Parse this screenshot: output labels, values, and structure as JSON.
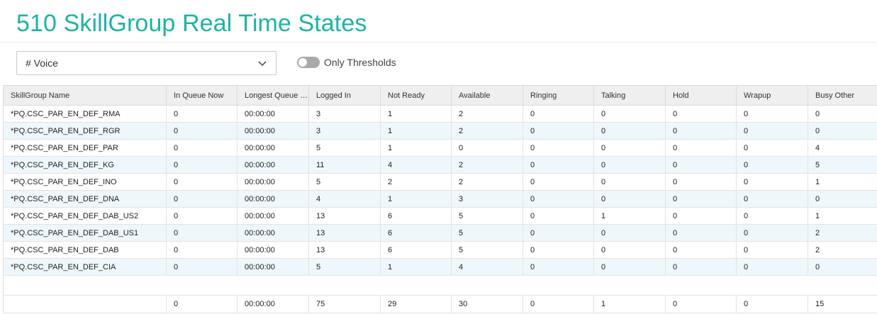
{
  "page": {
    "title": "510 SkillGroup Real Time States"
  },
  "filter": {
    "selected": "# Voice"
  },
  "toggle": {
    "label": "Only Thresholds",
    "on": false
  },
  "table": {
    "columns": [
      "SkillGroup Name",
      "In Queue Now",
      "Longest Queue T...",
      "Logged In",
      "Not Ready",
      "Available",
      "Ringing",
      "Talking",
      "Hold",
      "Wrapup",
      "Busy Other"
    ],
    "rows": [
      [
        "*PQ.CSC_PAR_EN_DEF_RMA",
        "0",
        "00:00:00",
        "3",
        "1",
        "2",
        "0",
        "0",
        "0",
        "0",
        "0"
      ],
      [
        "*PQ.CSC_PAR_EN_DEF_RGR",
        "0",
        "00:00:00",
        "3",
        "1",
        "2",
        "0",
        "0",
        "0",
        "0",
        "0"
      ],
      [
        "*PQ.CSC_PAR_EN_DEF_PAR",
        "0",
        "00:00:00",
        "5",
        "1",
        "0",
        "0",
        "0",
        "0",
        "0",
        "4"
      ],
      [
        "*PQ.CSC_PAR_EN_DEF_KG",
        "0",
        "00:00:00",
        "11",
        "4",
        "2",
        "0",
        "0",
        "0",
        "0",
        "5"
      ],
      [
        "*PQ.CSC_PAR_EN_DEF_INO",
        "0",
        "00:00:00",
        "5",
        "2",
        "2",
        "0",
        "0",
        "0",
        "0",
        "1"
      ],
      [
        "*PQ.CSC_PAR_EN_DEF_DNA",
        "0",
        "00:00:00",
        "4",
        "1",
        "3",
        "0",
        "0",
        "0",
        "0",
        "0"
      ],
      [
        "*PQ.CSC_PAR_EN_DEF_DAB_US2",
        "0",
        "00:00:00",
        "13",
        "6",
        "5",
        "0",
        "1",
        "0",
        "0",
        "1"
      ],
      [
        "*PQ.CSC_PAR_EN_DEF_DAB_US1",
        "0",
        "00:00:00",
        "13",
        "6",
        "5",
        "0",
        "0",
        "0",
        "0",
        "2"
      ],
      [
        "*PQ.CSC_PAR_EN_DEF_DAB",
        "0",
        "00:00:00",
        "13",
        "6",
        "5",
        "0",
        "0",
        "0",
        "0",
        "2"
      ],
      [
        "*PQ.CSC_PAR_EN_DEF_CIA",
        "0",
        "00:00:00",
        "5",
        "1",
        "4",
        "0",
        "0",
        "0",
        "0",
        "0"
      ]
    ],
    "totals": [
      "",
      "0",
      "00:00:00",
      "75",
      "29",
      "30",
      "0",
      "1",
      "0",
      "0",
      "15"
    ]
  }
}
